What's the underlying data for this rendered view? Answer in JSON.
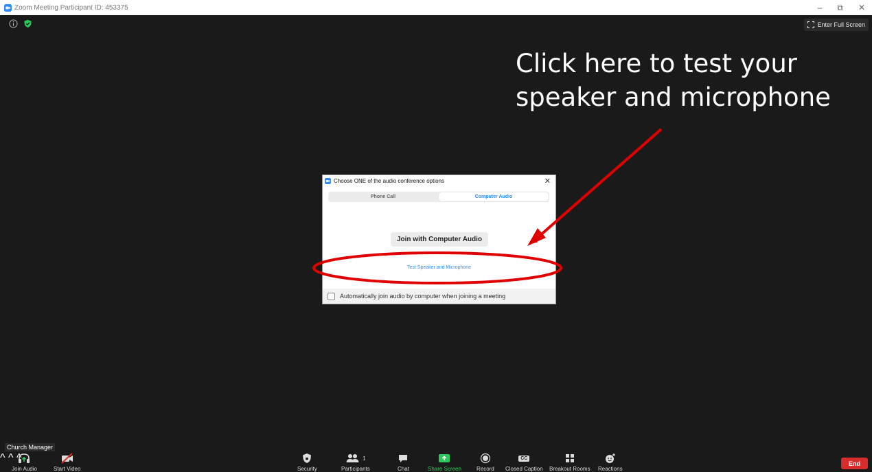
{
  "window": {
    "title": "Zoom Meeting Participant ID: 453375",
    "minimize": "–",
    "restore": "⧉",
    "close": "✕"
  },
  "top": {
    "fullscreen_label": "Enter Full Screen"
  },
  "annotation": {
    "line1": "Click here to test your",
    "line2": "speaker and microphone",
    "color": "#e00000"
  },
  "dialog": {
    "title": "Choose ONE of the audio conference options",
    "close": "✕",
    "tabs": [
      {
        "label": "Phone Call",
        "active": false
      },
      {
        "label": "Computer Audio",
        "active": true
      }
    ],
    "join_button": "Join with Computer Audio",
    "test_link": "Test Speaker and Microphone",
    "auto_join_label": "Automatically join audio by computer when joining a meeting",
    "auto_join_checked": false
  },
  "participant_name": "Church Manager",
  "toolbar": {
    "join_audio": "Join Audio",
    "start_video": "Start Video",
    "security": "Security",
    "participants": "Participants",
    "participants_count": "1",
    "chat": "Chat",
    "share_screen": "Share Screen",
    "record": "Record",
    "closed_caption": "Closed Caption",
    "closed_caption_icon_text": "CC",
    "breakout_rooms": "Breakout Rooms",
    "reactions": "Reactions",
    "caret": "^",
    "end": "End"
  },
  "colors": {
    "background": "#1a1a1a",
    "accent": "#2d8cff",
    "share_green": "#2ec95c",
    "end_red": "#d92d2d"
  }
}
